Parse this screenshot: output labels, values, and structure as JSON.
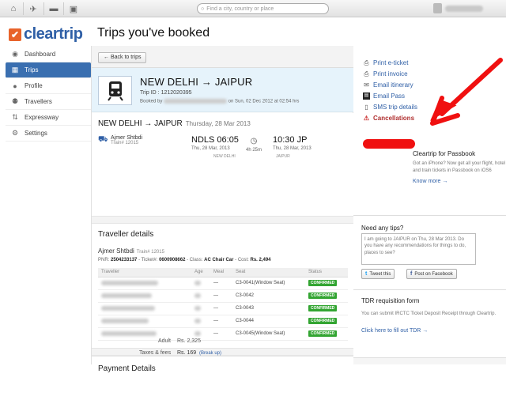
{
  "topbar": {
    "search_placeholder": "Find a city, country or place",
    "icons": [
      "home-icon",
      "flight-icon",
      "hotel-icon",
      "train-icon"
    ]
  },
  "logo": {
    "text": "cleartrip"
  },
  "page_title": "Trips you've booked",
  "sidebar": {
    "items": [
      {
        "label": "Dashboard",
        "icon": "eye-icon"
      },
      {
        "label": "Trips",
        "icon": "trips-icon",
        "active": true
      },
      {
        "label": "Profile",
        "icon": "person-icon"
      },
      {
        "label": "Travellers",
        "icon": "people-icon"
      },
      {
        "label": "Expressway",
        "icon": "arrows-icon"
      },
      {
        "label": "Settings",
        "icon": "gear-icon"
      }
    ]
  },
  "main": {
    "back_label": "← Back to trips",
    "trip": {
      "route": "NEW DELHI → JAIPUR",
      "trip_id": "Trip ID : 1212020395",
      "booked_prefix": "Booked by",
      "booked_suffix": "on Sun, 02 Dec 2012 at 02:54 hrs"
    },
    "journey": {
      "title": "NEW DELHI → JAIPUR",
      "date": "Thursday, 28 Mar 2013",
      "train_name": "Ajmer Shtbdi",
      "train_no": "Train# 12015",
      "dep_time": "NDLS 06:05",
      "dep_date": "Thu, 28 Mar, 2013",
      "dep_city": "NEW DELHI",
      "duration": "4h 25m",
      "arr_time": "10:30 JP",
      "arr_date": "Thu, 28 Mar, 2013",
      "arr_city": "JAIPUR"
    },
    "traveller": {
      "heading": "Traveller details",
      "train_name": "Ajmer Shtbdi",
      "train_no": "Train# 12015",
      "pnr_label": "PNR:",
      "pnr": "2504233137",
      "ticket_label": "- Ticket#:",
      "ticket": "0600908662",
      "class_label": "- Class:",
      "class": "AC Chair Car",
      "cost_label": "- Cost:",
      "cost": "Rs. 2,494",
      "columns": [
        "Traveller",
        "Age",
        "Meal",
        "Seat",
        "Status"
      ],
      "rows": [
        {
          "meal": "—",
          "seat": "C3-0041(Window Seat)",
          "status": "CONFIRMED"
        },
        {
          "meal": "—",
          "seat": "C3-0042",
          "status": "CONFIRMED"
        },
        {
          "meal": "—",
          "seat": "C3-0043",
          "status": "CONFIRMED"
        },
        {
          "meal": "—",
          "seat": "C3-0044",
          "status": "CONFIRMED"
        },
        {
          "meal": "—",
          "seat": "C3-0045(Window Seat)",
          "status": "CONFIRMED"
        }
      ]
    },
    "payment": {
      "heading": "Payment Details",
      "adult_label": "Adult",
      "adult_value": "Rs. 2,325",
      "taxes_label": "Taxes & fees",
      "taxes_value": "Rs. 169",
      "breakup": "(Break up)"
    }
  },
  "right": {
    "actions": [
      {
        "label": "Print e-ticket",
        "icon": "print-icon"
      },
      {
        "label": "Print invoice",
        "icon": "print-icon"
      },
      {
        "label": "Email itinerary",
        "icon": "email-icon"
      },
      {
        "label": "Email Pass",
        "icon": "pass-icon"
      },
      {
        "label": "SMS trip details",
        "icon": "phone-icon"
      },
      {
        "label": "Cancellations",
        "icon": "cancel-icon"
      }
    ],
    "passbook": {
      "heading": "Cleartrip for Passbook",
      "text": "Got an iPhone? Now get all your flight, hotel and train tickets in Passbook on iOS6",
      "link": "Know more →"
    },
    "tips": {
      "heading": "Need any tips?",
      "message": "I am going to JAIPUR on Thu, 28 Mar 2013. Do you have any recommendations for things to do, places to see?",
      "tweet": "Tweet this",
      "facebook": "Post on Facebook"
    },
    "tdr": {
      "heading": "TDR requisition form",
      "text": "You can submit IRCTC Ticket Deposit Receipt through Cleartrip.",
      "link": "Click here to fill out TDR →"
    }
  },
  "colors": {
    "brand_blue": "#2f5fa6",
    "brand_orange": "#e8632b",
    "confirmed": "#33a532",
    "annotation_red": "#f01010"
  }
}
